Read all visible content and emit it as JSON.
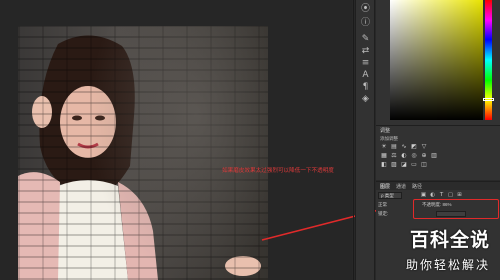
{
  "annotation": {
    "text": "如果磨皮效果太过强烈可以降低一下不透明度"
  },
  "adjustments": {
    "title": "调整",
    "subtitle": "添加调整"
  },
  "layers": {
    "tabs": [
      "图层",
      "通道",
      "路径"
    ],
    "kind": "ρ 类型",
    "blend_mode": "正常",
    "opacity_label": "不透明度:",
    "opacity_value": "86%",
    "lock_label": "锁定:"
  },
  "watermark": {
    "title": "百科全说",
    "subtitle": "助你轻松解决"
  },
  "colors": {
    "annotation": "#e03a3a",
    "highlight": "#e02a2a"
  }
}
